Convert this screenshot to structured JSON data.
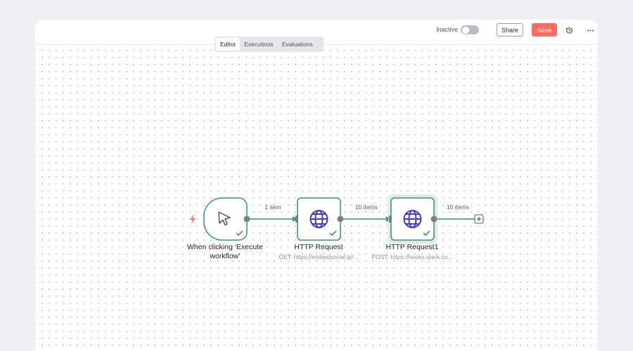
{
  "header": {
    "status_label": "Inactive",
    "share_label": "Share",
    "save_label": "Save",
    "history_icon": "history-icon",
    "more_icon": "more-horizontal-icon"
  },
  "tabs": [
    {
      "label": "Editor",
      "active": true
    },
    {
      "label": "Executions",
      "active": false
    },
    {
      "label": "Evaluations",
      "active": false
    }
  ],
  "nodes": [
    {
      "title_line1": "When clicking ‘Execute",
      "title_line2": "workflow’",
      "subtitle": "",
      "icon": "cursor-click-icon",
      "status": "success"
    },
    {
      "title_line1": "HTTP Request",
      "subtitle": "GET: https://embedsocial.jp/...",
      "icon": "globe-icon",
      "status": "success"
    },
    {
      "title_line1": "HTTP Request1",
      "subtitle": "POST: https://hooks.slack.co...",
      "icon": "globe-icon",
      "status": "success"
    }
  ],
  "edges": [
    {
      "label": "1 item"
    },
    {
      "label": "10 items"
    },
    {
      "label": "10 items"
    }
  ],
  "colors": {
    "accent": "#ff6b5b",
    "success": "#2f9e5b",
    "node_icon": "#3d3ad6",
    "trigger": "#ff6b5b"
  }
}
